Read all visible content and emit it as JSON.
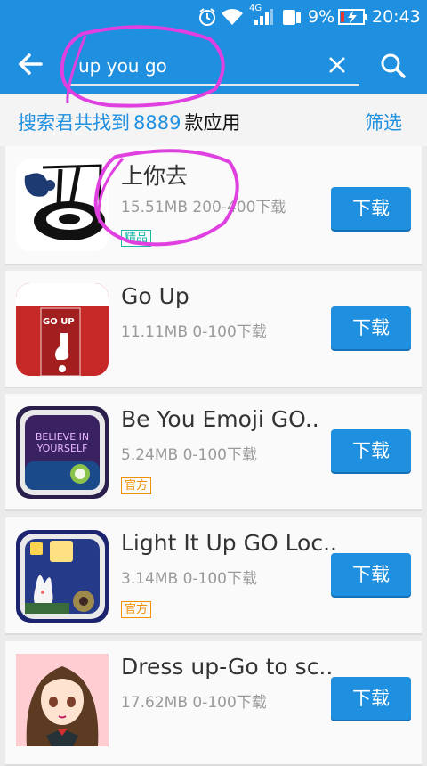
{
  "status_bar": {
    "network": "4G",
    "battery": "9%",
    "time": "20:43"
  },
  "header": {
    "search_value": "up you go"
  },
  "results": {
    "prefix": "搜索君共找到",
    "count": "8889",
    "suffix": "款应用",
    "filter_label": "筛选"
  },
  "download_label": "下载",
  "apps": [
    {
      "name": "上你去",
      "meta": "15.51MB  200-400下载",
      "badge": "精品"
    },
    {
      "name": "Go Up",
      "meta": "11.11MB  0-100下载",
      "badge": ""
    },
    {
      "name": "Be You Emoji GO..",
      "meta": "5.24MB  0-100下载",
      "badge": "官方"
    },
    {
      "name": "Light It Up GO Loc..",
      "meta": "3.14MB  0-100下载",
      "badge": "官方"
    },
    {
      "name": "Dress up-Go to sc..",
      "meta": "17.62MB  0-100下载",
      "badge": ""
    }
  ],
  "icon_text": {
    "go_up": "GO UP",
    "believe": "BELIEVE IN YOURSELF"
  },
  "colors": {
    "accent": "#1f8fe0",
    "badge_featured": "#18b7a8",
    "badge_official": "#f29100",
    "annotation": "#e040e0"
  }
}
